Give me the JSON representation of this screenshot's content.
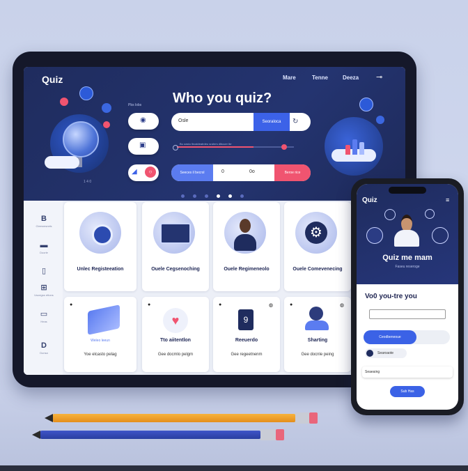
{
  "tablet": {
    "brand": "Quiz",
    "nav": [
      "Mare",
      "Tenne",
      "Deeza"
    ],
    "hero_title": "Who you quiz?",
    "small_label": "Pbs lobs",
    "globe_number": "1 4 0",
    "search": {
      "value": "Osle",
      "button": "Seoraloca"
    },
    "slider_text": "Bu oastu ltrcaldeatrdeu srahrrs dlbcuer ltrr",
    "bottom_row": {
      "left": "Seeces il becrsl",
      "mid1": "0",
      "mid2": "0o",
      "right": "Beroe rice"
    },
    "dots_count": 6,
    "active_dot": 3,
    "sidebar": [
      {
        "icon": "B",
        "label": "Cteesmsnels"
      },
      {
        "icon": "▬",
        "label": "Doorle"
      },
      {
        "icon": "▯",
        "label": ""
      },
      {
        "icon": "⊞",
        "label": "Usoegss ettons"
      },
      {
        "icon": "▭",
        "label": "Heas"
      },
      {
        "icon": "D",
        "label": "Dunsa"
      }
    ],
    "cards_top": [
      {
        "title": "Unlec Registeeation",
        "icon": "camera-icon"
      },
      {
        "title": "Ouele Cegsenoching",
        "icon": "computer-icon"
      },
      {
        "title": "Ouele Regimeneolo",
        "icon": "person-icon"
      },
      {
        "title": "Ouele Comevenecing",
        "icon": "gear-icon"
      }
    ],
    "cards_bottom": [
      {
        "title": "Weleo leeun",
        "sub": "Yoe elcasto pelag"
      },
      {
        "title": "Tto aiitentlon",
        "sub": "Gee docmlo pelgm"
      },
      {
        "title": "Reeuerdo",
        "sub": "Gee regeetnenm"
      },
      {
        "title": "Sharting",
        "sub": "Gee docnle peing"
      }
    ]
  },
  "phone": {
    "brand": "Quiz",
    "title": "Quiz me mam",
    "subtitle": "Faseu reseroge",
    "heading": "Vo0 you-tre you",
    "button": "Ceodbeneoue",
    "chip": "Searoaote",
    "field": "Seaeaing",
    "submit": "Sub Has"
  },
  "colors": {
    "navy": "#1f2c5e",
    "accent_blue": "#3c62e8",
    "accent_red": "#f05470"
  }
}
